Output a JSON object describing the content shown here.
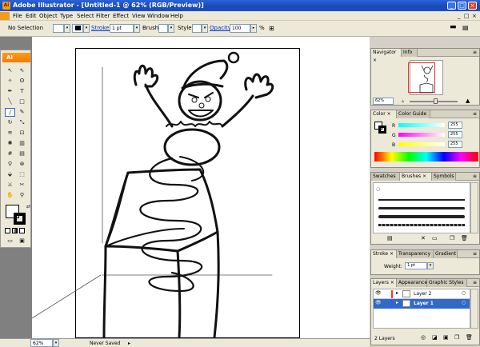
{
  "window": {
    "title": "Adobe Illustrator - [Untitled-1 @ 62% (RGB/Preview)]",
    "app_icon": "Ai",
    "doc_close": "×"
  },
  "menu": [
    "File",
    "Edit",
    "Object",
    "Type",
    "Select",
    "Filter",
    "Effect",
    "View",
    "Window",
    "Help"
  ],
  "control_bar": {
    "selection": "No Selection",
    "stroke_label": "Stroke:",
    "stroke_value": "1 pt",
    "brush_label": "Brush:",
    "style_label": "Style:",
    "opacity_label": "Opacity:",
    "opacity_value": "100",
    "percent": "%"
  },
  "toolbox": {
    "logo": "AI"
  },
  "status": {
    "zoom": "62%",
    "save_state": "Never Saved"
  },
  "navigator": {
    "tabs": [
      "Navigator",
      "Info"
    ],
    "zoom": "62%",
    "active_tab": "Navigator"
  },
  "color_panel": {
    "tabs": [
      "Color",
      "Color Guide"
    ],
    "channels": [
      {
        "label": "R",
        "value": "255"
      },
      {
        "label": "G",
        "value": "255"
      },
      {
        "label": "B",
        "value": "255"
      }
    ]
  },
  "brushes_panel": {
    "tabs": [
      "Swatches",
      "Brushes",
      "Symbols"
    ],
    "active_tab": "Brushes"
  },
  "stroke_panel": {
    "tabs": [
      "Stroke",
      "Transparency",
      "Gradient"
    ],
    "weight_label": "Weight:",
    "weight_value": "1 pt"
  },
  "layers_panel": {
    "tabs": [
      "Layers",
      "Appearance",
      "Graphic Styles"
    ],
    "layers": [
      {
        "name": "Layer 2",
        "selected": false,
        "color": "#ff3333"
      },
      {
        "name": "Layer 1",
        "selected": true,
        "color": "#3355ff"
      }
    ],
    "count": "2 Layers"
  },
  "colors": {
    "accent": "#316ac5",
    "orange": "#f27b00",
    "titlebar": "#1848b8"
  }
}
